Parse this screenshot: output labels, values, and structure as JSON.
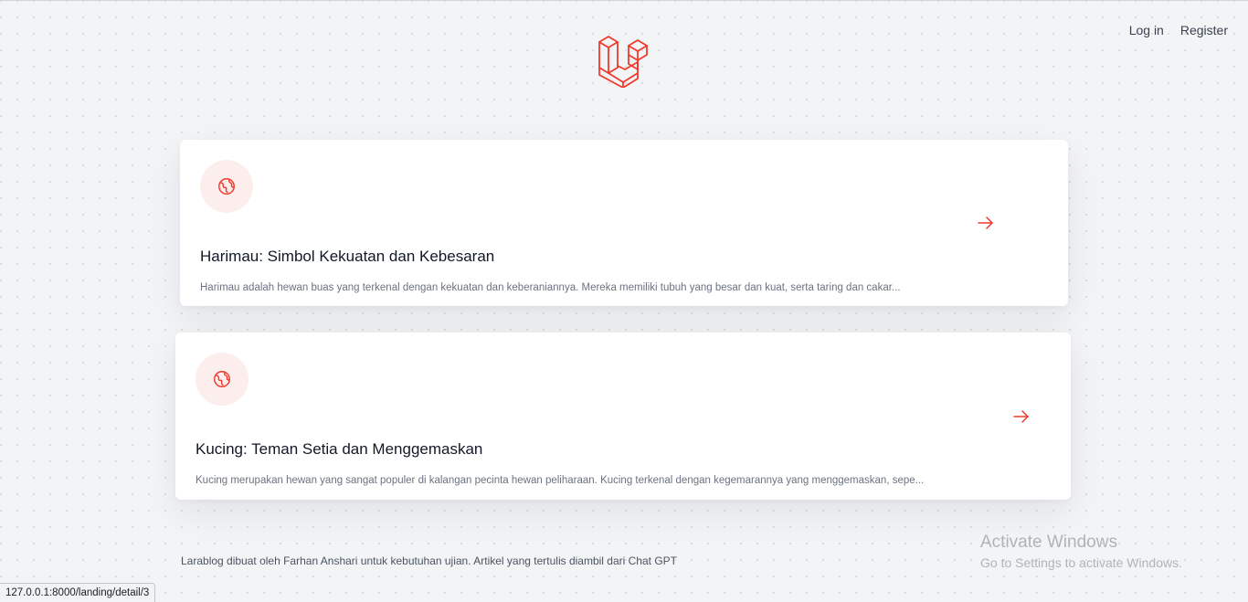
{
  "nav": {
    "login": "Log in",
    "register": "Register"
  },
  "logo": {
    "icon": "laravel-logo-icon",
    "color": "#ef3b2d"
  },
  "articles": [
    {
      "icon": "globe-icon",
      "title": "Harimau: Simbol Kekuatan dan Kebesaran",
      "excerpt": "Harimau adalah hewan buas yang terkenal dengan kekuatan dan keberaniannya. Mereka memiliki tubuh yang besar dan kuat, serta taring dan cakar..."
    },
    {
      "icon": "globe-icon",
      "title": "Kucing: Teman Setia dan Menggemaskan",
      "excerpt": "Kucing merupakan hewan yang sangat populer di kalangan pecinta hewan peliharaan. Kucing terkenal dengan kegemarannya yang menggemaskan, sepe..."
    }
  ],
  "footer": {
    "text": "Larablog dibuat oleh Farhan Anshari untuk kebutuhan ujian. Artikel yang tertulis diambil dari Chat GPT"
  },
  "watermark": {
    "title": "Activate Windows",
    "subtitle": "Go to Settings to activate Windows."
  },
  "status_bar": {
    "url": "127.0.0.1:8000/landing/detail/3"
  },
  "colors": {
    "accent": "#ef3b2d",
    "icon_bg": "#fdeeee",
    "page_bg": "#f3f4f6"
  }
}
